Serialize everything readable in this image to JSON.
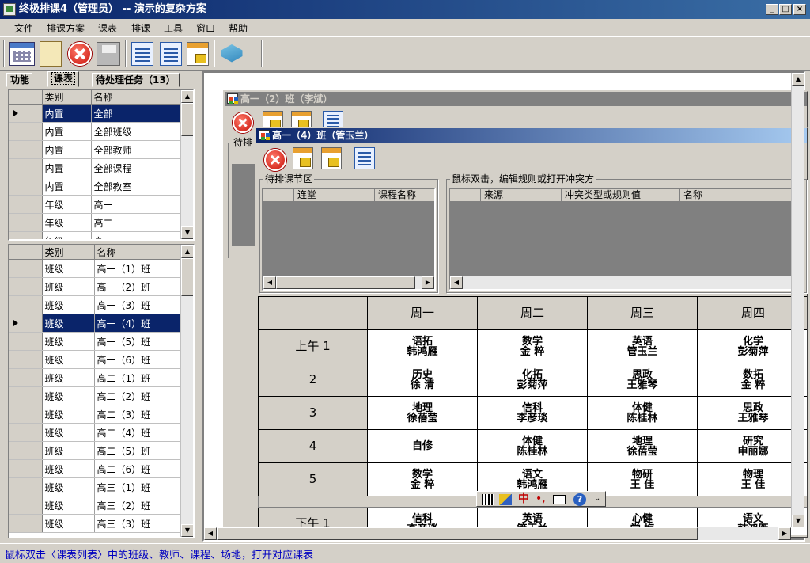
{
  "window": {
    "title": "终极排课4（管理员） -- 演示的复杂方案",
    "min": "_",
    "max": "□",
    "close": "×"
  },
  "menu": [
    "文件",
    "排课方案",
    "课表",
    "排课",
    "工具",
    "窗口",
    "帮助"
  ],
  "tabs": {
    "function": "功能",
    "schedule": "课表",
    "pending": "待处理任务（13）"
  },
  "top_grid": {
    "headers": [
      "类别",
      "名称"
    ],
    "rows": [
      {
        "category": "内置",
        "name": "全部"
      },
      {
        "category": "内置",
        "name": "全部班级"
      },
      {
        "category": "内置",
        "name": "全部教师"
      },
      {
        "category": "内置",
        "name": "全部课程"
      },
      {
        "category": "内置",
        "name": "全部教室"
      },
      {
        "category": "年级",
        "name": "高一"
      },
      {
        "category": "年级",
        "name": "高二"
      },
      {
        "category": "年级",
        "name": "高三"
      }
    ]
  },
  "bottom_grid": {
    "headers": [
      "类别",
      "名称"
    ],
    "rows": [
      {
        "category": "班级",
        "name": "高一（1）班"
      },
      {
        "category": "班级",
        "name": "高一（2）班"
      },
      {
        "category": "班级",
        "name": "高一（3）班"
      },
      {
        "category": "班级",
        "name": "高一（4）班"
      },
      {
        "category": "班级",
        "name": "高一（5）班"
      },
      {
        "category": "班级",
        "name": "高一（6）班"
      },
      {
        "category": "班级",
        "name": "高二（1）班"
      },
      {
        "category": "班级",
        "name": "高二（2）班"
      },
      {
        "category": "班级",
        "name": "高二（3）班"
      },
      {
        "category": "班级",
        "name": "高二（4）班"
      },
      {
        "category": "班级",
        "name": "高二（5）班"
      },
      {
        "category": "班级",
        "name": "高二（6）班"
      },
      {
        "category": "班级",
        "name": "高三（1）班"
      },
      {
        "category": "班级",
        "name": "高三（2）班"
      },
      {
        "category": "班级",
        "name": "高三（3）班"
      }
    ]
  },
  "back_window": {
    "title": "高一（2）班（李斌）",
    "group_label": "待排"
  },
  "front_window": {
    "title": "高一（4）班（管玉兰）",
    "pending_label": "待排课节区",
    "pending_cols": [
      "连堂",
      "课程名称"
    ],
    "conflict_label": "鼠标双击，编辑规则或打开冲突方",
    "conflict_cols": [
      "来源",
      "冲突类型或规则值",
      "名称"
    ],
    "days": [
      "周一",
      "周二",
      "周三",
      "周四"
    ],
    "periods": [
      {
        "label": "上午 1",
        "cells": [
          [
            "语拓",
            "韩鸿雁"
          ],
          [
            "数学",
            "金  粹"
          ],
          [
            "英语",
            "管玉兰"
          ],
          [
            "化学",
            "彭菊萍"
          ]
        ]
      },
      {
        "label": "2",
        "cells": [
          [
            "历史",
            "徐  清"
          ],
          [
            "化拓",
            "彭菊萍"
          ],
          [
            "思政",
            "王雅琴"
          ],
          [
            "数拓",
            "金  粹"
          ]
        ]
      },
      {
        "label": "3",
        "cells": [
          [
            "地理",
            "徐蓓莹"
          ],
          [
            "信科",
            "李彦琰"
          ],
          [
            "体健",
            "陈桂林"
          ],
          [
            "思政",
            "王雅琴"
          ]
        ]
      },
      {
        "label": "4",
        "cells": [
          [
            "自修",
            ""
          ],
          [
            "体健",
            "陈桂林"
          ],
          [
            "地理",
            "徐蓓莹"
          ],
          [
            "研究",
            "申丽娜"
          ]
        ]
      },
      {
        "label": "5",
        "cells": [
          [
            "数学",
            "金  粹"
          ],
          [
            "语文",
            "韩鸿雁"
          ],
          [
            "物研",
            "王  佳"
          ],
          [
            "物理",
            "王  佳"
          ]
        ]
      }
    ],
    "afternoon": {
      "label": "下午 1",
      "cells": [
        [
          "信科",
          "李彦琰"
        ],
        [
          "英语",
          "管玉兰"
        ],
        [
          "心健",
          "堂  梅"
        ],
        [
          "语文",
          "韩鸿雁"
        ]
      ]
    }
  },
  "ime": {
    "mode": "中",
    "punct": "•,"
  },
  "status": "鼠标双击〈课表列表〉中的班级、教师、课程、场地，打开对应课表"
}
